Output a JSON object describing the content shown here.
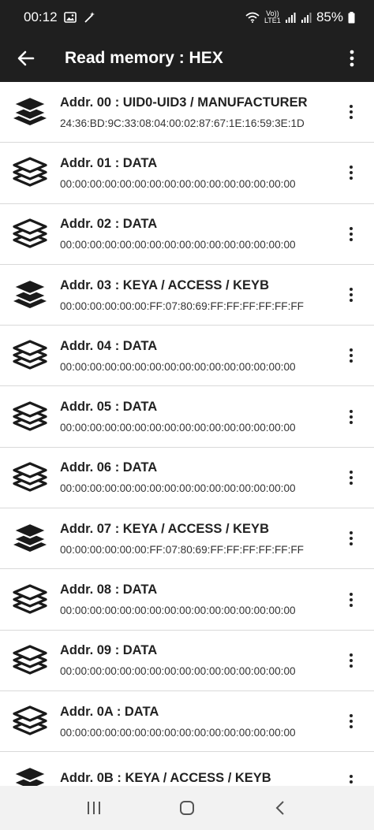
{
  "status": {
    "time": "00:12",
    "network_label": "Vo)) LTE1",
    "battery": "85%"
  },
  "appbar": {
    "title": "Read memory : HEX"
  },
  "rows": [
    {
      "title": "Addr. 00 : UID0-UID3 / MANUFACTURER",
      "value": "24:36:BD:9C:33:08:04:00:02:87:67:1E:16:59:3E:1D",
      "icon": "layers-filled-icon"
    },
    {
      "title": "Addr. 01 : DATA",
      "value": "00:00:00:00:00:00:00:00:00:00:00:00:00:00:00:00",
      "icon": "layers-outline-icon"
    },
    {
      "title": "Addr. 02 : DATA",
      "value": "00:00:00:00:00:00:00:00:00:00:00:00:00:00:00:00",
      "icon": "layers-outline-icon"
    },
    {
      "title": "Addr. 03 : KEYA / ACCESS / KEYB",
      "value": "00:00:00:00:00:00:FF:07:80:69:FF:FF:FF:FF:FF:FF",
      "icon": "layers-filled-icon"
    },
    {
      "title": "Addr. 04 : DATA",
      "value": "00:00:00:00:00:00:00:00:00:00:00:00:00:00:00:00",
      "icon": "layers-outline-icon"
    },
    {
      "title": "Addr. 05 : DATA",
      "value": "00:00:00:00:00:00:00:00:00:00:00:00:00:00:00:00",
      "icon": "layers-outline-icon"
    },
    {
      "title": "Addr. 06 : DATA",
      "value": "00:00:00:00:00:00:00:00:00:00:00:00:00:00:00:00",
      "icon": "layers-outline-icon"
    },
    {
      "title": "Addr. 07 : KEYA / ACCESS / KEYB",
      "value": "00:00:00:00:00:00:FF:07:80:69:FF:FF:FF:FF:FF:FF",
      "icon": "layers-filled-icon"
    },
    {
      "title": "Addr. 08 : DATA",
      "value": "00:00:00:00:00:00:00:00:00:00:00:00:00:00:00:00",
      "icon": "layers-outline-icon"
    },
    {
      "title": "Addr. 09 : DATA",
      "value": "00:00:00:00:00:00:00:00:00:00:00:00:00:00:00:00",
      "icon": "layers-outline-icon"
    },
    {
      "title": "Addr. 0A : DATA",
      "value": "00:00:00:00:00:00:00:00:00:00:00:00:00:00:00:00",
      "icon": "layers-outline-icon"
    },
    {
      "title": "Addr. 0B : KEYA / ACCESS / KEYB",
      "value": "",
      "icon": "layers-filled-icon"
    }
  ],
  "colors": {
    "appbar_bg": "#1f1f1f",
    "list_bg": "#ffffff",
    "text": "#222222"
  }
}
